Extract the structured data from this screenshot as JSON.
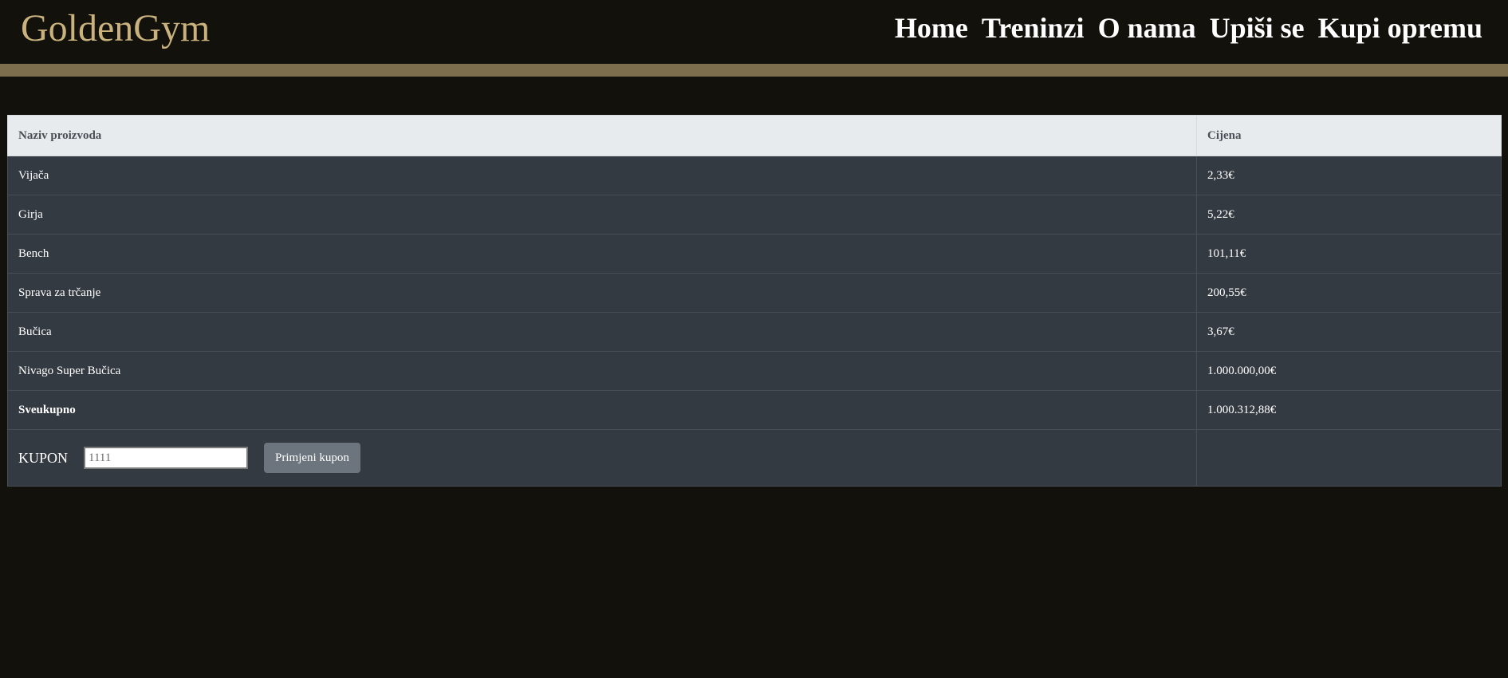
{
  "header": {
    "logo": "GoldenGym",
    "nav": [
      "Home",
      "Treninzi",
      "O nama",
      "Upiši se",
      "Kupi opremu"
    ]
  },
  "table": {
    "columns": [
      "Naziv proizvoda",
      "Cijena"
    ],
    "rows": [
      {
        "name": "Vijača",
        "price": "2,33€"
      },
      {
        "name": "Girja",
        "price": "5,22€"
      },
      {
        "name": "Bench",
        "price": "101,11€"
      },
      {
        "name": "Sprava za trčanje",
        "price": "200,55€"
      },
      {
        "name": "Bučica",
        "price": "3,67€"
      },
      {
        "name": "Nivago Super Bučica",
        "price": "1.000.000,00€"
      }
    ],
    "total": {
      "label": "Sveukupno",
      "price": "1.000.312,88€"
    }
  },
  "coupon": {
    "label": "KUPON",
    "value": "1111",
    "button_label": "Primjeni kupon"
  },
  "colors": {
    "background": "#13110b",
    "logo": "#c9b27e",
    "accent_bar": "#7d6e4d",
    "table_header_bg": "#e8ebee",
    "table_row_bg": "#343a41",
    "button_bg": "#6c757e"
  }
}
